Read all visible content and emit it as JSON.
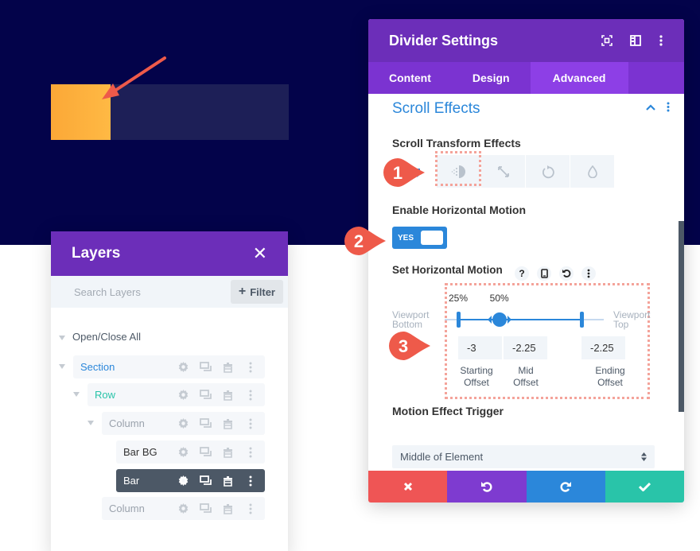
{
  "canvas": {
    "colors": {
      "hero_bg": "#03034a",
      "bar_bg": "#1d1f57",
      "bar": "#fba837",
      "annotation": "#ee5a4a"
    }
  },
  "layers_panel": {
    "title": "Layers",
    "close_icon": "close-icon",
    "search_placeholder": "Search Layers",
    "filter_label": "Filter",
    "open_close_all": "Open/Close All",
    "items": [
      {
        "label": "Section",
        "color": "#2b87da",
        "active": false
      },
      {
        "label": "Row",
        "color": "#29c4a9",
        "active": false
      },
      {
        "label": "Column",
        "color": "#9aa2ac",
        "active": false
      },
      {
        "label": "Bar BG",
        "color": "#333333",
        "active": false
      },
      {
        "label": "Bar",
        "color": "#ffffff",
        "active": true
      },
      {
        "label": "Column",
        "color": "#9aa2ac",
        "active": false
      }
    ],
    "row_actions": [
      "gear-icon",
      "duplicate-icon",
      "trash-icon",
      "more-icon"
    ]
  },
  "settings_panel": {
    "title": "Divider Settings",
    "header_icons": [
      "fullscreen-icon",
      "split-view-icon",
      "more-vertical-icon"
    ],
    "tabs": [
      {
        "label": "Content",
        "active": false
      },
      {
        "label": "Design",
        "active": false
      },
      {
        "label": "Advanced",
        "active": true
      }
    ],
    "section_title": "Scroll Effects",
    "scroll_transform_label": "Scroll Transform Effects",
    "effects": [
      {
        "name": "horizontal-motion",
        "selected": true
      },
      {
        "name": "fading",
        "selected": false
      },
      {
        "name": "scaling",
        "selected": false
      },
      {
        "name": "rotating",
        "selected": false
      },
      {
        "name": "blur",
        "selected": false
      }
    ],
    "enable_label": "Enable Horizontal Motion",
    "toggle_label": "YES",
    "toggle_on": true,
    "set_motion_label": "Set Horizontal Motion",
    "motion_icons": [
      "help-icon",
      "mobile-icon",
      "reset-icon",
      "more-icon"
    ],
    "viewport_bottom": [
      "Viewport",
      "Bottom"
    ],
    "viewport_top": [
      "Viewport",
      "Top"
    ],
    "start_pct": "25%",
    "mid_pct": "50%",
    "start_value": 0.25,
    "mid_value": 0.5,
    "end_value": 1.0,
    "offsets": {
      "starting": "-3",
      "mid": "-2.25",
      "ending": "-2.25"
    },
    "offset_labels": {
      "starting": [
        "Starting",
        "Offset"
      ],
      "mid": [
        "Mid",
        "Offset"
      ],
      "ending": [
        "Ending",
        "Offset"
      ]
    },
    "trigger_label": "Motion Effect Trigger",
    "trigger_value": "Middle of Element",
    "footer_buttons": [
      {
        "name": "cancel",
        "icon": "close-icon",
        "color": "#ef5555"
      },
      {
        "name": "undo",
        "icon": "undo-icon",
        "color": "#7e3bd0"
      },
      {
        "name": "redo",
        "icon": "redo-icon",
        "color": "#2b87da"
      },
      {
        "name": "save",
        "icon": "check-icon",
        "color": "#29c4a9"
      }
    ]
  },
  "annotations": {
    "badges": [
      "1",
      "2",
      "3"
    ]
  }
}
